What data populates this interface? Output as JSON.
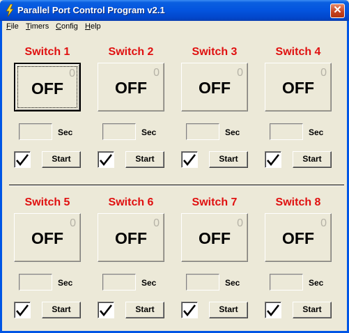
{
  "window": {
    "title": "Parallel Port Control Program v2.1",
    "close_glyph": "✕"
  },
  "menu": [
    {
      "key": "F",
      "rest": "ile"
    },
    {
      "key": "T",
      "rest": "imers"
    },
    {
      "key": "C",
      "rest": "onfig"
    },
    {
      "key": "H",
      "rest": "elp"
    }
  ],
  "colors": {
    "switch_label": "#e01010",
    "titlebar": "#0354de"
  },
  "switches": [
    {
      "label": "Switch 1",
      "state": "OFF",
      "count": "0",
      "timer_value": "",
      "unit": "Sec",
      "auto_checked": true,
      "start_label": "Start"
    },
    {
      "label": "Switch 2",
      "state": "OFF",
      "count": "0",
      "timer_value": "",
      "unit": "Sec",
      "auto_checked": true,
      "start_label": "Start"
    },
    {
      "label": "Switch 3",
      "state": "OFF",
      "count": "0",
      "timer_value": "",
      "unit": "Sec",
      "auto_checked": true,
      "start_label": "Start"
    },
    {
      "label": "Switch 4",
      "state": "OFF",
      "count": "0",
      "timer_value": "",
      "unit": "Sec",
      "auto_checked": true,
      "start_label": "Start"
    },
    {
      "label": "Switch 5",
      "state": "OFF",
      "count": "0",
      "timer_value": "",
      "unit": "Sec",
      "auto_checked": true,
      "start_label": "Start"
    },
    {
      "label": "Switch 6",
      "state": "OFF",
      "count": "0",
      "timer_value": "",
      "unit": "Sec",
      "auto_checked": true,
      "start_label": "Start"
    },
    {
      "label": "Switch 7",
      "state": "OFF",
      "count": "0",
      "timer_value": "",
      "unit": "Sec",
      "auto_checked": true,
      "start_label": "Start"
    },
    {
      "label": "Switch 8",
      "state": "OFF",
      "count": "0",
      "timer_value": "",
      "unit": "Sec",
      "auto_checked": true,
      "start_label": "Start"
    }
  ]
}
